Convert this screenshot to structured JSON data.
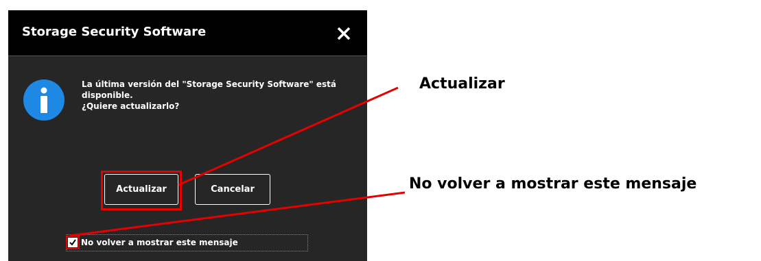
{
  "dialog": {
    "title": "Storage Security Software",
    "close_icon": "close-icon",
    "info_icon": "info-icon",
    "message_line1": "La última versión del \"Storage Security Software\" está",
    "message_line2": "disponible.",
    "message_line3": "¿Quiere actualizarlo?",
    "update_label": "Actualizar",
    "cancel_label": "Cancelar",
    "checkbox_label": "No volver a mostrar este mensaje",
    "checkbox_checked": true
  },
  "annotations": {
    "update": "Actualizar",
    "no_show": "No volver a mostrar este mensaje"
  },
  "colors": {
    "dialog_bg": "#262626",
    "titlebar_bg": "#000000",
    "info_blue": "#1e88e5",
    "highlight_red": "#e60000"
  }
}
